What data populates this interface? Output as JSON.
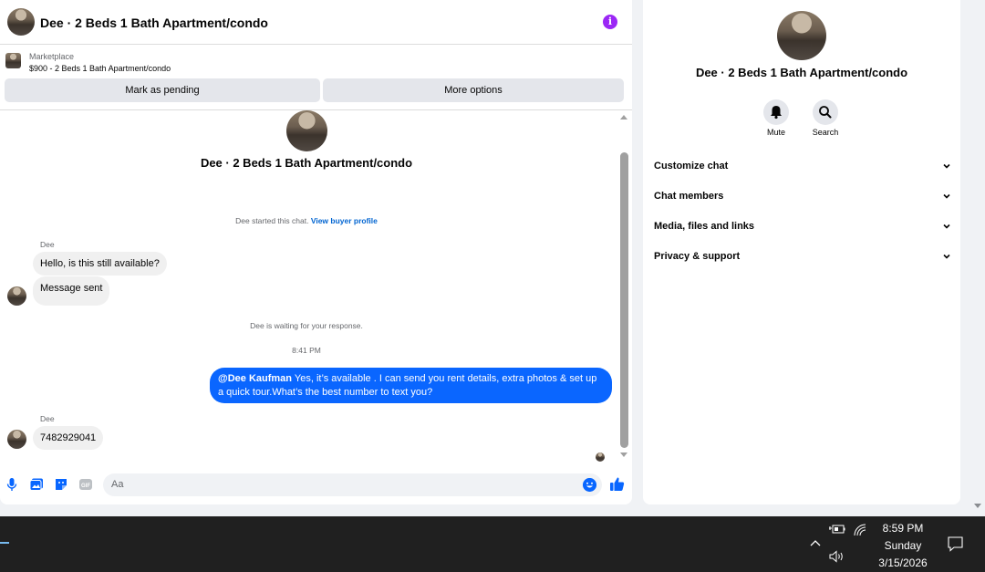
{
  "header": {
    "title": "Dee · 2 Beds 1 Bath Apartment/condo"
  },
  "marketplace": {
    "label": "Marketplace",
    "listing": "$900 - 2 Beds 1 Bath Apartment/condo",
    "pending_button": "Mark as pending",
    "more_button": "More options"
  },
  "thread": {
    "title": "Dee · 2 Beds 1 Bath Apartment/condo",
    "started_text": "Dee started this chat.",
    "view_profile_link": "View buyer profile",
    "messages": [
      {
        "sender": "Dee",
        "text": "Hello, is this still available?"
      },
      {
        "text": "Message sent"
      }
    ],
    "waiting_note": "Dee is waiting for your response.",
    "timestamp": "8:41 PM",
    "outgoing": {
      "mention": "@Dee Kaufman",
      "text": "Yes, it’s available .  I can send you rent details, extra photos & set up a quick tour.What’s the best number to text you?"
    },
    "reply": {
      "sender": "Dee",
      "text": "7482929041"
    }
  },
  "composer": {
    "placeholder": "Aa"
  },
  "info_panel": {
    "title": "Dee · 2 Beds 1 Bath Apartment/condo",
    "mute_label": "Mute",
    "search_label": "Search",
    "sections": [
      "Customize chat",
      "Chat members",
      "Media, files and links",
      "Privacy & support"
    ]
  },
  "taskbar": {
    "time": "8:59 PM",
    "day": "Sunday",
    "date": "3/15/2026"
  },
  "colors": {
    "accent": "#0866ff",
    "outgoing_bubble": "#0a66ff",
    "info_icon": "#9b27f5",
    "taskbar": "#202020"
  }
}
